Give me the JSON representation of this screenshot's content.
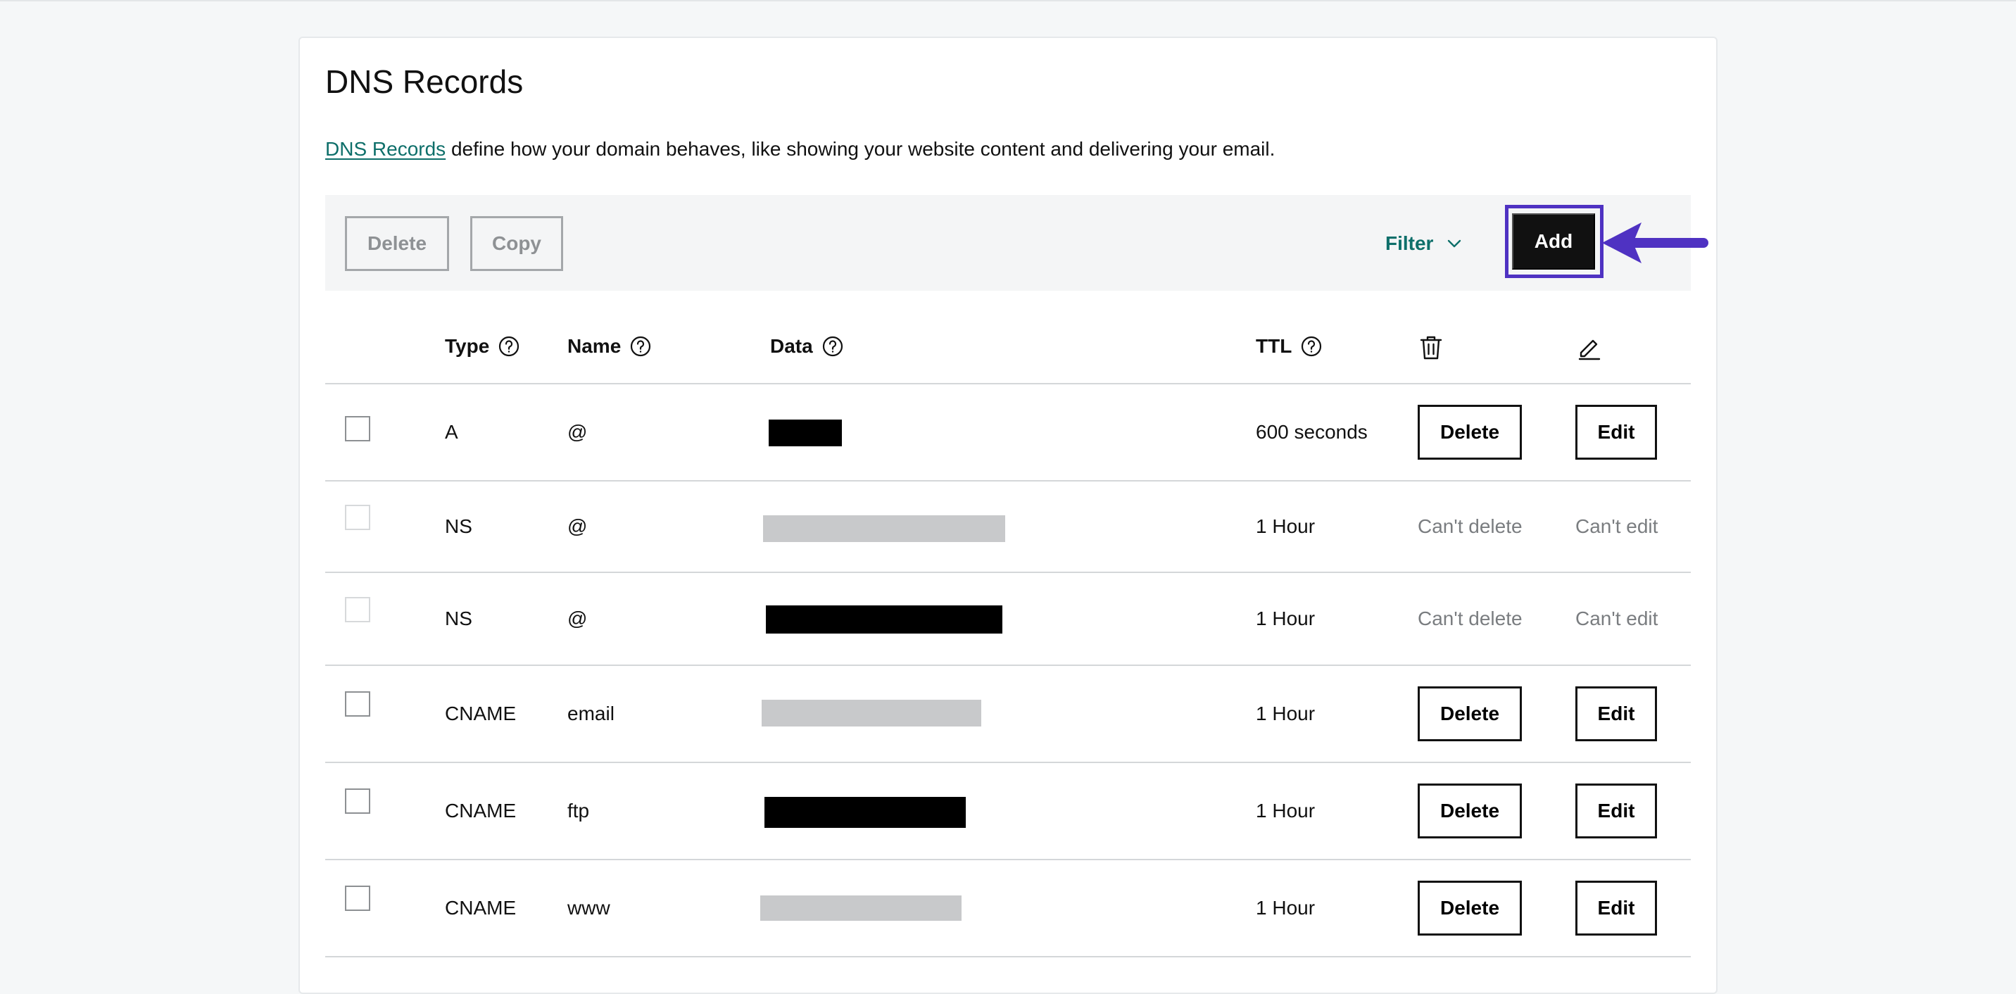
{
  "page": {
    "title": "DNS Records",
    "intro_link": "DNS Records",
    "intro_text": " define how your domain behaves, like showing your website content and delivering your email."
  },
  "toolbar": {
    "delete_label": "Delete",
    "copy_label": "Copy",
    "filter_label": "Filter",
    "add_label": "Add"
  },
  "colors": {
    "accent_teal": "#0e6f6a",
    "highlight_purple": "#4f32c2",
    "primary_button": "#111111"
  },
  "table": {
    "headers": {
      "type": "Type",
      "name": "Name",
      "data": "Data",
      "ttl": "TTL",
      "delete_icon": "trash-icon",
      "edit_icon": "pencil-icon"
    },
    "rows": [
      {
        "type": "A",
        "name": "@",
        "data": "[redacted]",
        "ttl": "600 seconds",
        "delete": "Delete",
        "edit": "Edit",
        "editable": true
      },
      {
        "type": "NS",
        "name": "@",
        "data": "[redacted]",
        "ttl": "1 Hour",
        "delete": "Can't delete",
        "edit": "Can't edit",
        "editable": false
      },
      {
        "type": "NS",
        "name": "@",
        "data": "[redacted]",
        "ttl": "1 Hour",
        "delete": "Can't delete",
        "edit": "Can't edit",
        "editable": false
      },
      {
        "type": "CNAME",
        "name": "email",
        "data": "[redacted]",
        "ttl": "1 Hour",
        "delete": "Delete",
        "edit": "Edit",
        "editable": true
      },
      {
        "type": "CNAME",
        "name": "ftp",
        "data": "[redacted]",
        "ttl": "1 Hour",
        "delete": "Delete",
        "edit": "Edit",
        "editable": true
      },
      {
        "type": "CNAME",
        "name": "www",
        "data": "[redacted]",
        "ttl": "1 Hour",
        "delete": "Delete",
        "edit": "Edit",
        "editable": true
      }
    ]
  }
}
